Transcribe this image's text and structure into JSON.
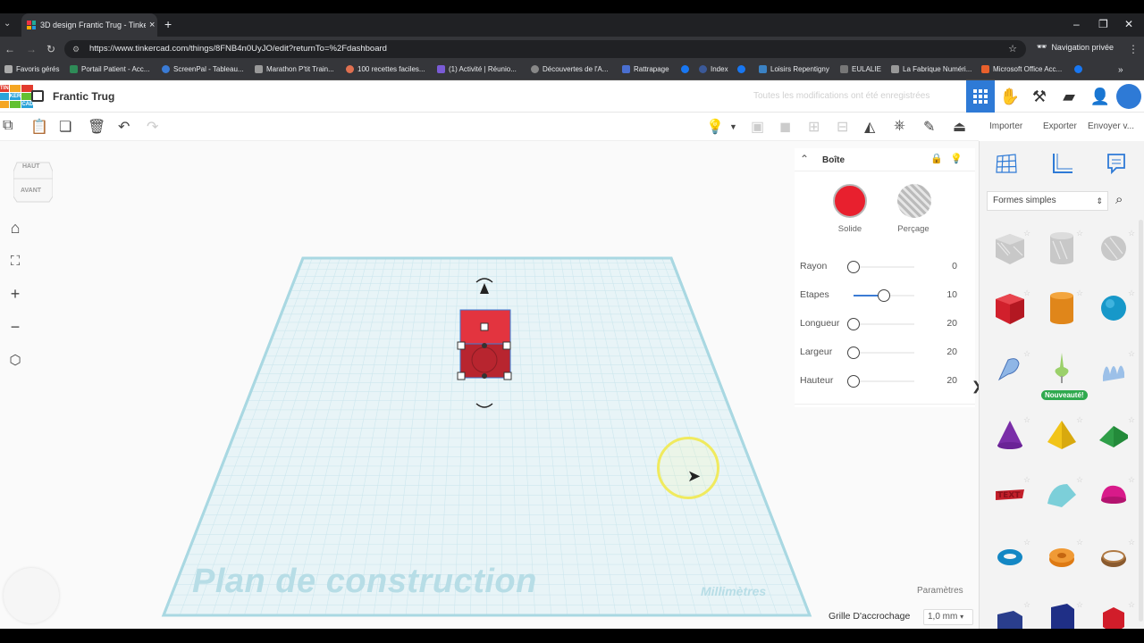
{
  "browser": {
    "tab_title": "3D design Frantic Trug - Tinkercad",
    "new_tab_icon": "+",
    "url": "https://www.tinkercad.com/things/8FNB4n0UyJO/edit?returnTo=%2Fdashboard",
    "private_label": "Navigation privée",
    "bookmarks": [
      {
        "label": "Favoris gérés",
        "color": "#aaaaaa"
      },
      {
        "label": "Portail Patient - Acc...",
        "color": "#2e8b57"
      },
      {
        "label": "ScreenPal - Tableau...",
        "color": "#3a7bd5"
      },
      {
        "label": "Marathon P'tit Train...",
        "color": "#999999"
      },
      {
        "label": "100 recettes faciles...",
        "color": "#e07050"
      },
      {
        "label": "(1) Activité | Réunio...",
        "color": "#7a5bd6"
      },
      {
        "label": "Découvertes de l'A...",
        "color": "#888888"
      },
      {
        "label": "Rattrapage",
        "color": "#4a6fd0"
      },
      {
        "label": "Index",
        "color": "#3b5998"
      },
      {
        "label": "Loisirs Repentigny",
        "color": "#3b82c4"
      },
      {
        "label": "EULALIE",
        "color": "#777777"
      },
      {
        "label": "La Fabrique Numéri...",
        "color": "#999999"
      },
      {
        "label": "Microsoft Office Acc...",
        "color": "#e8602c"
      }
    ]
  },
  "header": {
    "logo_letters": [
      "TIN",
      "KER",
      "CAD"
    ],
    "design_name": "Frantic Trug",
    "save_status": "Toutes les modifications ont été enregistrées"
  },
  "side_tabs": {
    "import": "Importer",
    "export": "Exporter",
    "send": "Envoyer v..."
  },
  "viewcube": {
    "top": "HAUT",
    "front": "AVANT"
  },
  "workplane": {
    "label": "Plan de construction",
    "units": "Millimètres",
    "params": "Paramètres",
    "grid_label": "Grille D'accrochage",
    "grid_value": "1,0 mm"
  },
  "inspector": {
    "title": "Boîte",
    "solid_label": "Solide",
    "hole_label": "Perçage",
    "solid_color": "#e8202e",
    "properties": [
      {
        "label": "Rayon",
        "value": "0",
        "level": 0.0
      },
      {
        "label": "Etapes",
        "value": "10",
        "level": 0.5
      },
      {
        "label": "Longueur",
        "value": "20",
        "level": 0.0
      },
      {
        "label": "Largeur",
        "value": "20",
        "level": 0.0
      },
      {
        "label": "Hauteur",
        "value": "20",
        "level": 0.0
      }
    ]
  },
  "shapes_panel": {
    "category": "Formes simples",
    "new_badge": "Nouveauté!",
    "shapes": [
      "box-hole",
      "cylinder-hole",
      "sphere-hole",
      "box",
      "cylinder",
      "sphere",
      "scribble",
      "new-shape",
      "wave",
      "cone",
      "pyramid",
      "roof",
      "text",
      "half-sphere-wedge",
      "paraboloid",
      "torus",
      "tube",
      "ring",
      "polygon",
      "hexagonal-prism",
      "icosahedron"
    ]
  }
}
